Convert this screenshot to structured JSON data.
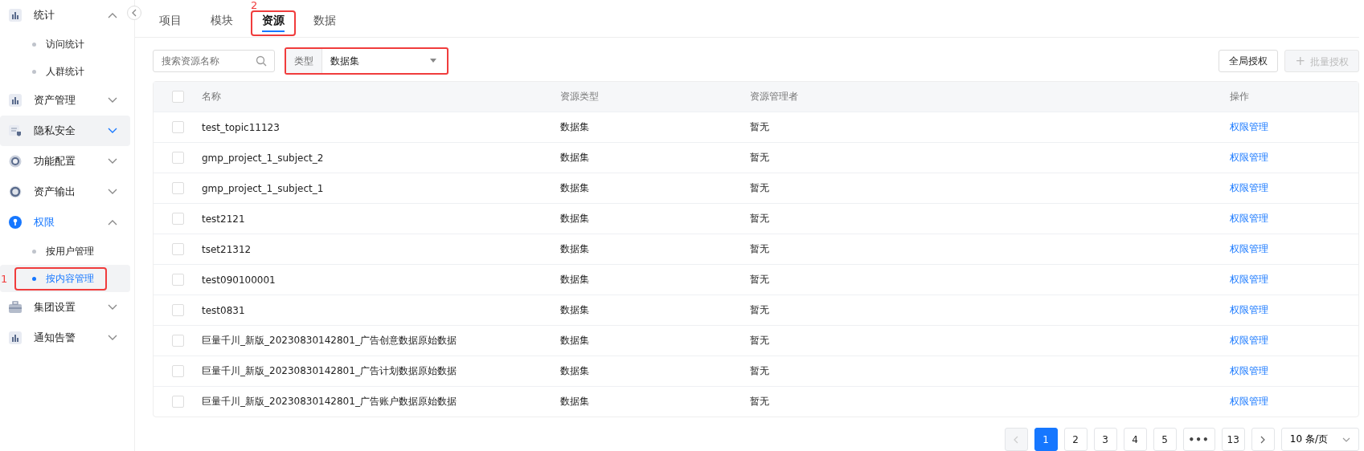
{
  "sidebar": {
    "items": [
      {
        "label": "统计",
        "expanded": true,
        "selected": false,
        "hovered": false,
        "children": [
          {
            "label": "访问统计",
            "selected": false
          },
          {
            "label": "人群统计",
            "selected": false
          }
        ]
      },
      {
        "label": "资产管理",
        "expanded": false,
        "selected": false,
        "hovered": false
      },
      {
        "label": "隐私安全",
        "expanded": false,
        "selected": false,
        "hovered": true
      },
      {
        "label": "功能配置",
        "expanded": false,
        "selected": false,
        "hovered": false
      },
      {
        "label": "资产输出",
        "expanded": false,
        "selected": false,
        "hovered": false
      },
      {
        "label": "权限",
        "expanded": true,
        "selected": true,
        "hovered": false,
        "children": [
          {
            "label": "按用户管理",
            "selected": false
          },
          {
            "label": "按内容管理",
            "selected": true,
            "callout": "1"
          }
        ]
      },
      {
        "label": "集团设置",
        "expanded": false,
        "selected": false,
        "hovered": false
      },
      {
        "label": "通知告警",
        "expanded": false,
        "selected": false,
        "hovered": false
      }
    ]
  },
  "tabs": [
    {
      "label": "项目",
      "selected": false
    },
    {
      "label": "模块",
      "selected": false
    },
    {
      "label": "资源",
      "selected": true,
      "callout": "2"
    },
    {
      "label": "数据",
      "selected": false
    }
  ],
  "search": {
    "placeholder": "搜索资源名称"
  },
  "type_filter": {
    "label": "类型",
    "value": "数据集",
    "highlighted": true
  },
  "buttons": [
    {
      "label": "全局授权",
      "disabled": false
    },
    {
      "label": "批量授权",
      "disabled": true,
      "icon": "+"
    }
  ],
  "table": {
    "header_checked": false,
    "columns": [
      "名称",
      "资源类型",
      "资源管理者",
      "操作"
    ],
    "rows": [
      {
        "name": "test_topic11123",
        "type": "数据集",
        "manager": "暂无",
        "action": "权限管理",
        "checked": false
      },
      {
        "name": "gmp_project_1_subject_2",
        "type": "数据集",
        "manager": "暂无",
        "action": "权限管理",
        "checked": false
      },
      {
        "name": "gmp_project_1_subject_1",
        "type": "数据集",
        "manager": "暂无",
        "action": "权限管理",
        "checked": false
      },
      {
        "name": "test2121",
        "type": "数据集",
        "manager": "暂无",
        "action": "权限管理",
        "checked": false
      },
      {
        "name": "tset21312",
        "type": "数据集",
        "manager": "暂无",
        "action": "权限管理",
        "checked": false
      },
      {
        "name": "test090100001",
        "type": "数据集",
        "manager": "暂无",
        "action": "权限管理",
        "checked": false
      },
      {
        "name": "test0831",
        "type": "数据集",
        "manager": "暂无",
        "action": "权限管理",
        "checked": false
      },
      {
        "name": "巨量千川_新版_20230830142801_广告创意数据原始数据",
        "type": "数据集",
        "manager": "暂无",
        "action": "权限管理",
        "checked": false
      },
      {
        "name": "巨量千川_新版_20230830142801_广告计划数据原始数据",
        "type": "数据集",
        "manager": "暂无",
        "action": "权限管理",
        "checked": false
      },
      {
        "name": "巨量千川_新版_20230830142801_广告账户数据原始数据",
        "type": "数据集",
        "manager": "暂无",
        "action": "权限管理",
        "checked": false
      }
    ]
  },
  "pagination": {
    "pages": [
      {
        "label": "1",
        "selected": true,
        "kind": "page"
      },
      {
        "label": "2",
        "selected": false,
        "kind": "page"
      },
      {
        "label": "3",
        "selected": false,
        "kind": "page"
      },
      {
        "label": "4",
        "selected": false,
        "kind": "page"
      },
      {
        "label": "5",
        "selected": false,
        "kind": "page"
      },
      {
        "label": "•••",
        "selected": false,
        "kind": "ellipsis"
      },
      {
        "label": "13",
        "selected": false,
        "kind": "page"
      }
    ],
    "prev_disabled": true,
    "next_disabled": false,
    "page_size": "10 条/页"
  }
}
